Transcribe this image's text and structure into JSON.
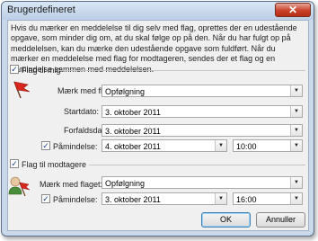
{
  "dialog": {
    "title": "Brugerdefineret",
    "close_label": "✕",
    "description": "Hvis du mærker en meddelelse til dig selv med flag, oprettes der en udestående opgave, som minder dig om, at du skal følge op på den. Når du har fulgt op på meddelelsen, kan du mærke den udestående opgave som fuldført. Når du mærker en meddelelse med flag for modtageren, sendes der et flag og en påmindelse sammen med meddelelsen.",
    "flag_me": {
      "label": "Flag til mig",
      "checked": true,
      "icon": "red-flag-icon",
      "flag_label": "Mærk med flaget:",
      "flag_value": "Opfølgning",
      "start_label": "Startdato:",
      "start_value": "3. oktober 2011",
      "due_label": "Forfaldsdato:",
      "due_value": "3. oktober 2011",
      "reminder_label": "Påmindelse:",
      "reminder_checked": true,
      "reminder_date": "4. oktober 2011",
      "reminder_time": "10:00"
    },
    "flag_recipients": {
      "label": "Flag til modtagere",
      "checked": true,
      "icon": "recipient-flag-icon",
      "flag_label": "Mærk med flaget:",
      "flag_value": "Opfølgning",
      "reminder_label": "Påmindelse:",
      "reminder_checked": true,
      "reminder_date": "3. oktober 2011",
      "reminder_time": "16:00"
    },
    "ok_label": "OK",
    "cancel_label": "Annuller"
  }
}
